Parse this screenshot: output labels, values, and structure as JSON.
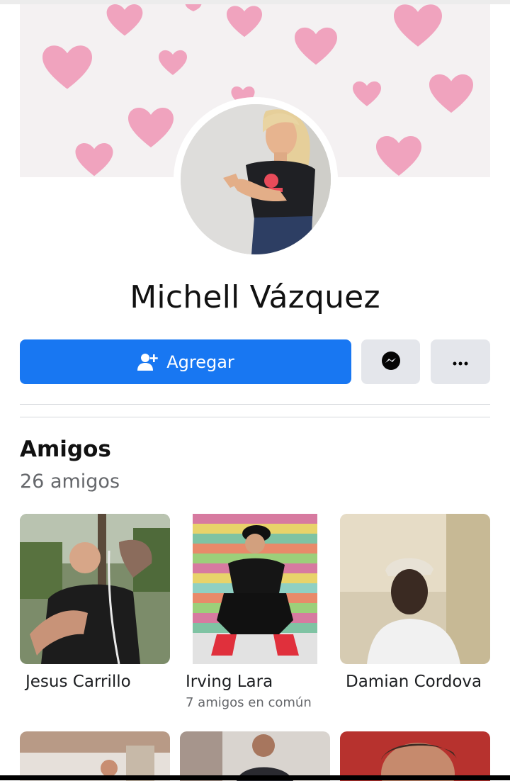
{
  "profile": {
    "name": "Michell Vázquez"
  },
  "actions": {
    "add_label": "Agregar",
    "messenger_icon": "messenger-icon",
    "more_icon": "more-icon"
  },
  "friends_section": {
    "title": "Amigos",
    "count_label": "26 amigos",
    "friends": [
      {
        "name": "Jesus Carrillo",
        "mutual": ""
      },
      {
        "name": "Irving Lara",
        "mutual": "7 amigos en común"
      },
      {
        "name": "Damian Cordova",
        "mutual": ""
      }
    ]
  },
  "colors": {
    "primary": "#1877f2",
    "button_gray": "#e4e6eb",
    "secondary_text": "#65676b",
    "heart_pink": "#ef9ab8"
  }
}
